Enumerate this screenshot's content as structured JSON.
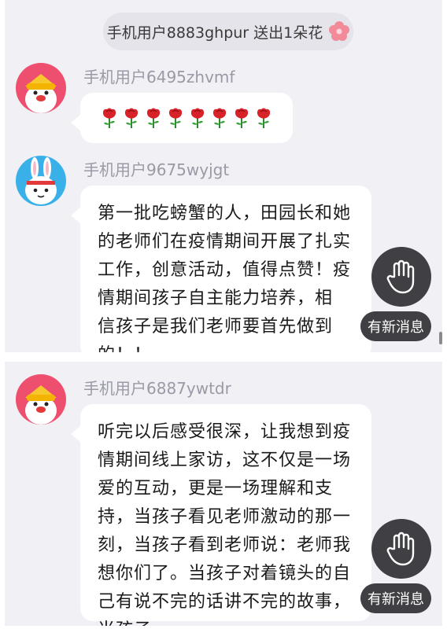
{
  "panel1": {
    "gift_banner": {
      "text": "手机用户8883ghpur 送出1朵花",
      "icon": "flower-icon"
    },
    "messages": [
      {
        "username": "手机用户6495zhvmf",
        "avatar": "chick-avatar",
        "rose_count": 8
      },
      {
        "username": "手机用户9675wyjgt",
        "avatar": "bunny-avatar",
        "lines": [
          "第一批吃螃蟹的人，田园长和她",
          "的老师们在疫情期间开展了扎实",
          "工作，创意活动，值得点赞！疫",
          "情期间孩子自主能力培养，相",
          "信孩子是我们老师要首先做到",
          "的！！"
        ]
      }
    ],
    "new_message_label": "有新消息"
  },
  "panel2": {
    "messages": [
      {
        "username": "手机用户6887ywtdr",
        "avatar": "chick-avatar",
        "lines": [
          "听完以后感受很深，让我想到疫",
          "情期间线上家访，这不仅是一场",
          "爱的互动，更是一场理解和支",
          "持，当孩子看见老师激动的那一",
          "刻，当孩子看到老师说：老师我",
          "想你们了。当孩子对着镜头的自",
          "己有说不完的话讲不完的故事，",
          "当孩子"
        ]
      }
    ],
    "new_message_label": "有新消息"
  },
  "colors": {
    "background": "#f0f0f5",
    "bubble": "#ffffff",
    "username": "#9a9aa6",
    "floating_button": "#3f3f44",
    "rose": "#d8222a"
  }
}
